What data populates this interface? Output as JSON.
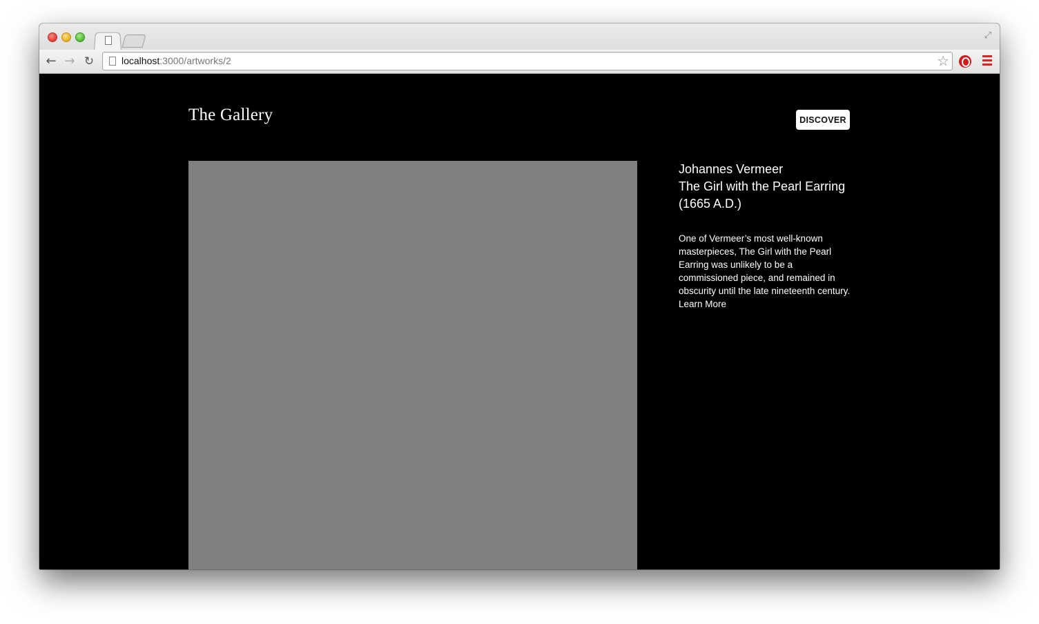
{
  "browser": {
    "url_host": "localhost",
    "url_path": ":3000/artworks/2"
  },
  "site": {
    "title": "The Gallery",
    "discover_label": "DISCOVER"
  },
  "artwork": {
    "artist": "Johannes Vermeer",
    "title": "The Girl with the Pearl Earring",
    "date": "(1665 A.D.)",
    "description": "One of Vermeer’s most well-known masterpieces, The Girl with the Pearl Earring was unlikely to be a commissioned piece, and remained in obscurity until the late nineteenth century.",
    "learn_more_label": "Learn More",
    "image_placeholder_color": "#808080"
  },
  "icons": {
    "back": "arrow-left-icon",
    "forward": "arrow-right-icon",
    "reload": "reload-icon",
    "bookmark": "star-icon",
    "extension": "opera-icon",
    "menu": "hamburger-menu-icon"
  }
}
